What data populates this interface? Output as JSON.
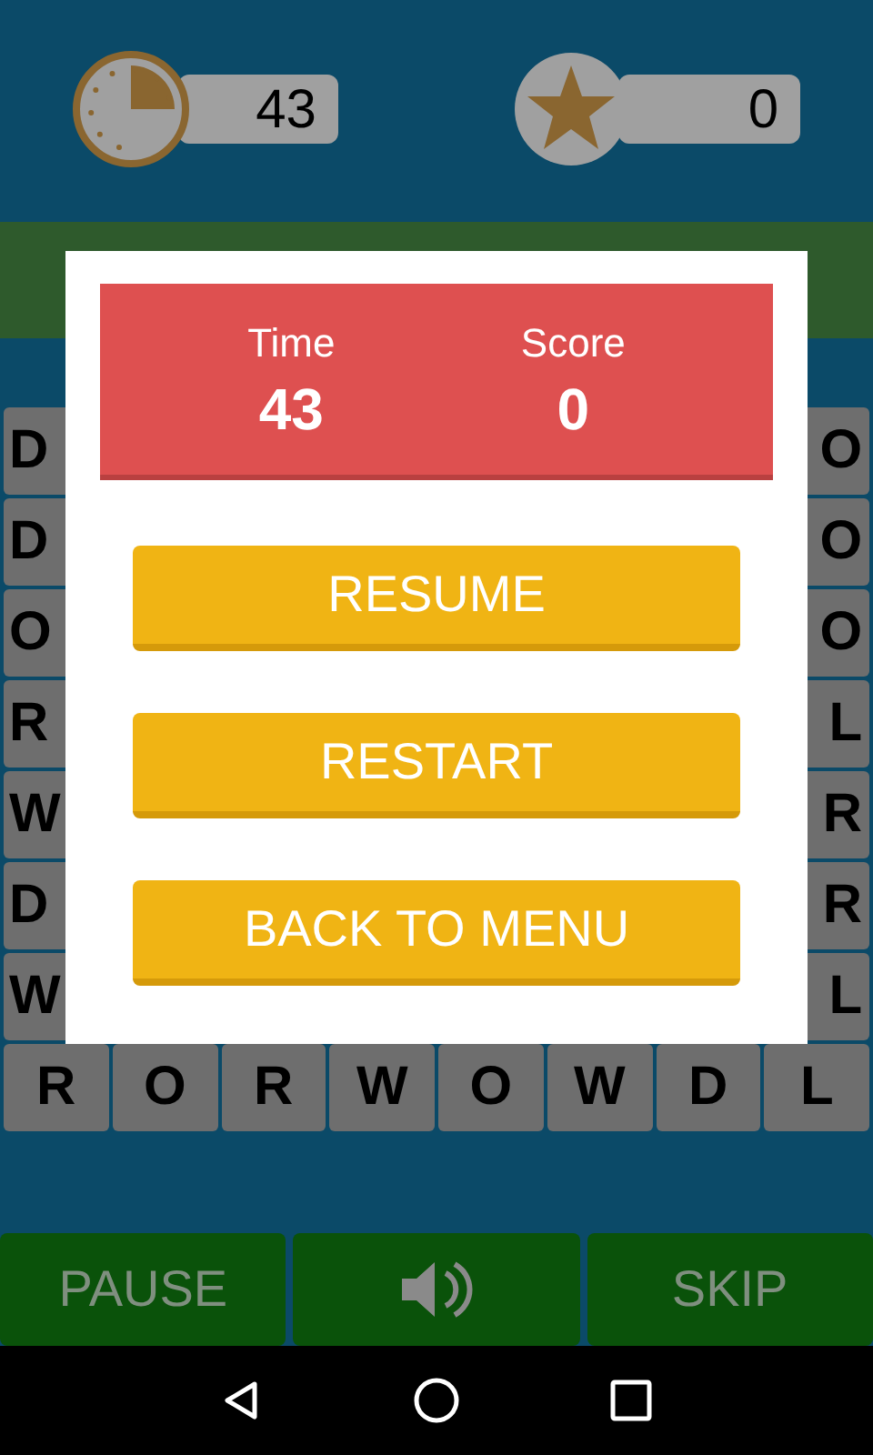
{
  "hud": {
    "time": "43",
    "score": "0"
  },
  "grid": {
    "side_rows": [
      {
        "left": "D",
        "right": "O"
      },
      {
        "left": "D",
        "right": "O"
      },
      {
        "left": "O",
        "right": "O"
      },
      {
        "left": "R",
        "right": "L"
      },
      {
        "left": "W",
        "right": "R"
      },
      {
        "left": "D",
        "right": "R"
      },
      {
        "left": "W",
        "right": "L"
      }
    ],
    "bottom_row": [
      "R",
      "O",
      "R",
      "W",
      "O",
      "W",
      "D",
      "L"
    ]
  },
  "pause_dialog": {
    "stats": [
      {
        "label": "Time",
        "value": "43"
      },
      {
        "label": "Score",
        "value": "0"
      }
    ],
    "buttons": [
      "RESUME",
      "RESTART",
      "BACK TO MENU"
    ]
  },
  "toolbar": {
    "pause": "PAUSE",
    "skip": "SKIP",
    "sound_on": true
  }
}
